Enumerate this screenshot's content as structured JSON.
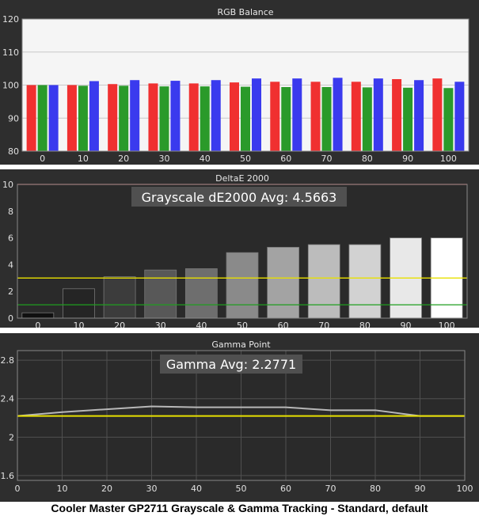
{
  "caption": "Cooler Master GP2711 Grayscale & Gamma Tracking - Standard, default",
  "colors": {
    "panel_bg": "#2e2e2e",
    "plot_bg": "#f5f5f5",
    "red": "#f03030",
    "green": "#2a9a2a",
    "blue": "#3a3aee",
    "threshold_yellow": "#e8e000",
    "threshold_green": "#1e9e1e",
    "limit_red": "#e04040",
    "gamma_target": "#e8e000",
    "gamma_measured": "#b8b8b8"
  },
  "chart_data": [
    {
      "type": "bar",
      "title": "RGB Balance",
      "categories": [
        "0",
        "10",
        "20",
        "30",
        "40",
        "50",
        "60",
        "70",
        "80",
        "90",
        "100"
      ],
      "ylim": [
        80,
        120
      ],
      "yticks": [
        "80",
        "90",
        "100",
        "110",
        "120"
      ],
      "grid": true,
      "series": [
        {
          "color": "red",
          "values": [
            100,
            100,
            100.3,
            100.5,
            100.5,
            100.8,
            101,
            101,
            101,
            101.8,
            102
          ]
        },
        {
          "color": "green",
          "values": [
            100,
            99.8,
            99.8,
            99.6,
            99.6,
            99.5,
            99.4,
            99.4,
            99.3,
            99.2,
            99.1
          ]
        },
        {
          "color": "blue",
          "values": [
            100,
            101.2,
            101.5,
            101.3,
            101.5,
            102,
            102,
            102.2,
            102,
            101.5,
            101
          ]
        }
      ]
    },
    {
      "type": "bar",
      "title": "DeltaE 2000",
      "annotation": "Grayscale dE2000 Avg: 4.5663",
      "categories": [
        "0",
        "10",
        "20",
        "30",
        "40",
        "50",
        "60",
        "70",
        "80",
        "90",
        "100"
      ],
      "values": [
        0.4,
        2.2,
        3.1,
        3.6,
        3.7,
        4.9,
        5.3,
        5.5,
        5.5,
        6.0,
        6.0
      ],
      "bar_shades": [
        "#101010",
        "#252525",
        "#3c3c3c",
        "#585858",
        "#6e6e6e",
        "#8a8a8a",
        "#a3a3a3",
        "#bcbcbc",
        "#d2d2d2",
        "#e8e8e8",
        "#ffffff"
      ],
      "ylim": [
        0,
        10
      ],
      "yticks": [
        "0",
        "2",
        "4",
        "6",
        "8",
        "10"
      ],
      "threshold_lines": [
        1,
        3,
        10
      ]
    },
    {
      "type": "line",
      "title": "Gamma Point",
      "annotation": "Gamma Avg: 2.2771",
      "x": [
        0,
        10,
        20,
        30,
        40,
        50,
        60,
        70,
        80,
        90,
        100
      ],
      "xticks": [
        "0",
        "10",
        "20",
        "30",
        "40",
        "50",
        "60",
        "70",
        "80",
        "90",
        "100"
      ],
      "ylim": [
        1.55,
        2.9
      ],
      "yticks": [
        "1.6",
        "2",
        "2.4",
        "2.8"
      ],
      "ytick_values": [
        1.6,
        2.0,
        2.4,
        2.8
      ],
      "series": [
        {
          "role": "target",
          "values": [
            2.22,
            2.22,
            2.22,
            2.22,
            2.22,
            2.22,
            2.22,
            2.22,
            2.22,
            2.22,
            2.22
          ]
        },
        {
          "role": "measured",
          "values": [
            2.22,
            2.26,
            2.29,
            2.32,
            2.31,
            2.31,
            2.31,
            2.28,
            2.28,
            2.22,
            2.22
          ]
        }
      ]
    }
  ]
}
